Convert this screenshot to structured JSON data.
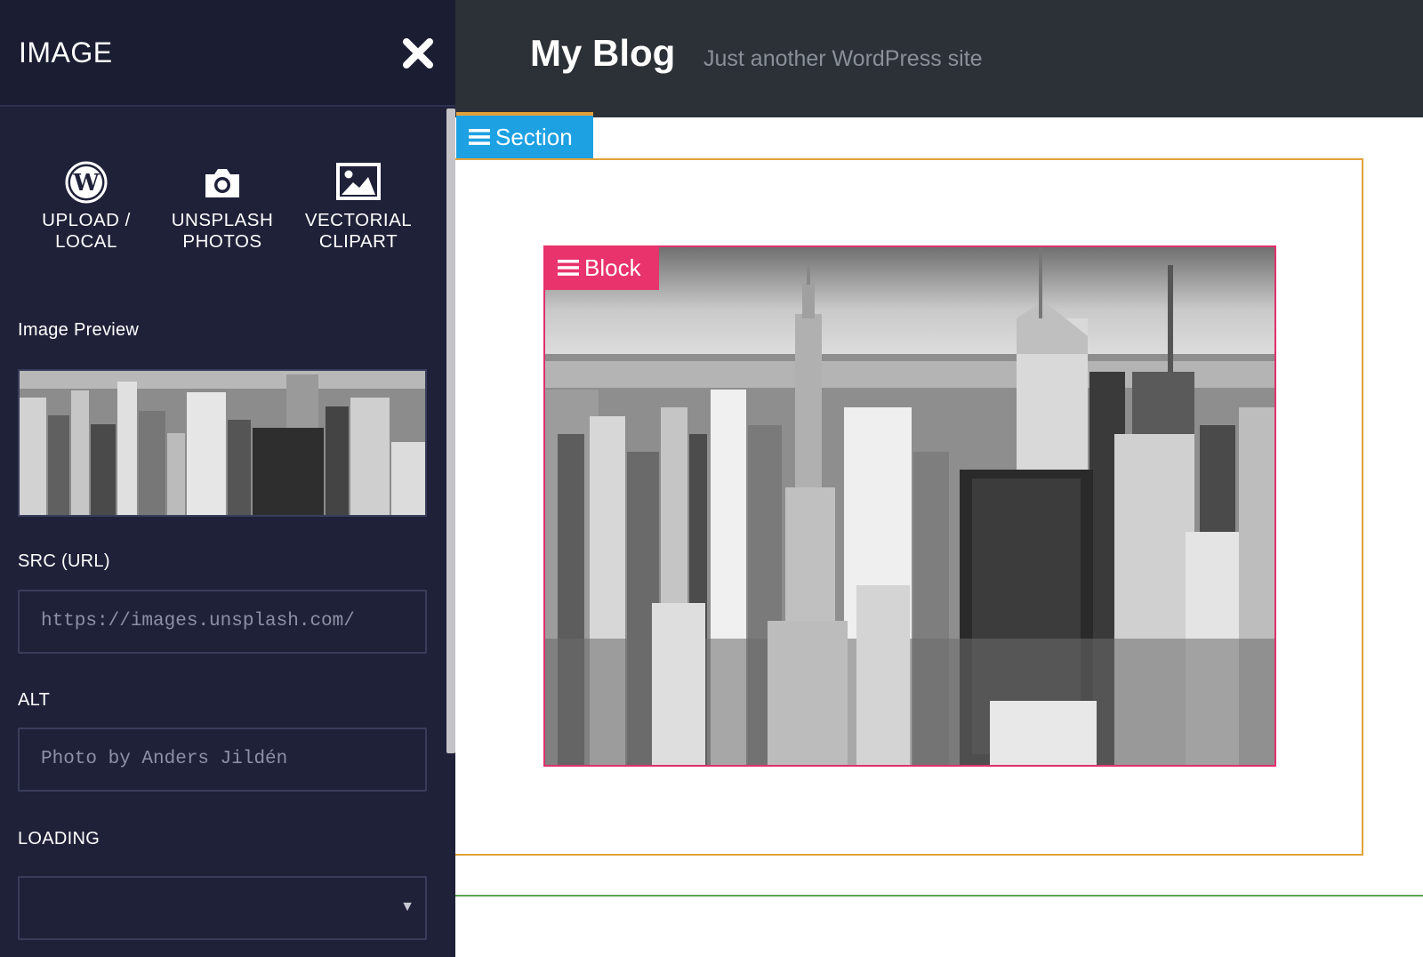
{
  "panel": {
    "title": "IMAGE",
    "close_icon": "close-icon"
  },
  "sources": [
    {
      "label": "UPLOAD /\nLOCAL",
      "icon": "wordpress-icon"
    },
    {
      "label": "UNSPLASH\nPHOTOS",
      "icon": "camera-icon"
    },
    {
      "label": "VECTORIAL\nCLIPART",
      "icon": "picture-icon"
    }
  ],
  "fields": {
    "preview_label": "Image Preview",
    "src_label": "SRC (URL)",
    "src_value": "https://images.unsplash.com/",
    "alt_label": "ALT",
    "alt_value": "Photo by Anders Jildén",
    "loading_label": "LOADING",
    "loading_value": ""
  },
  "site": {
    "title": "My Blog",
    "tagline": "Just another WordPress site"
  },
  "tags": {
    "section": "Section",
    "block": "Block"
  },
  "colors": {
    "sidebar_bg": "#1f2139",
    "site_header_bg": "#2c3137",
    "section_accent": "#1da1e3",
    "section_border": "#e2a13a",
    "block_accent": "#e8336c",
    "divider_green": "#5aa752"
  }
}
